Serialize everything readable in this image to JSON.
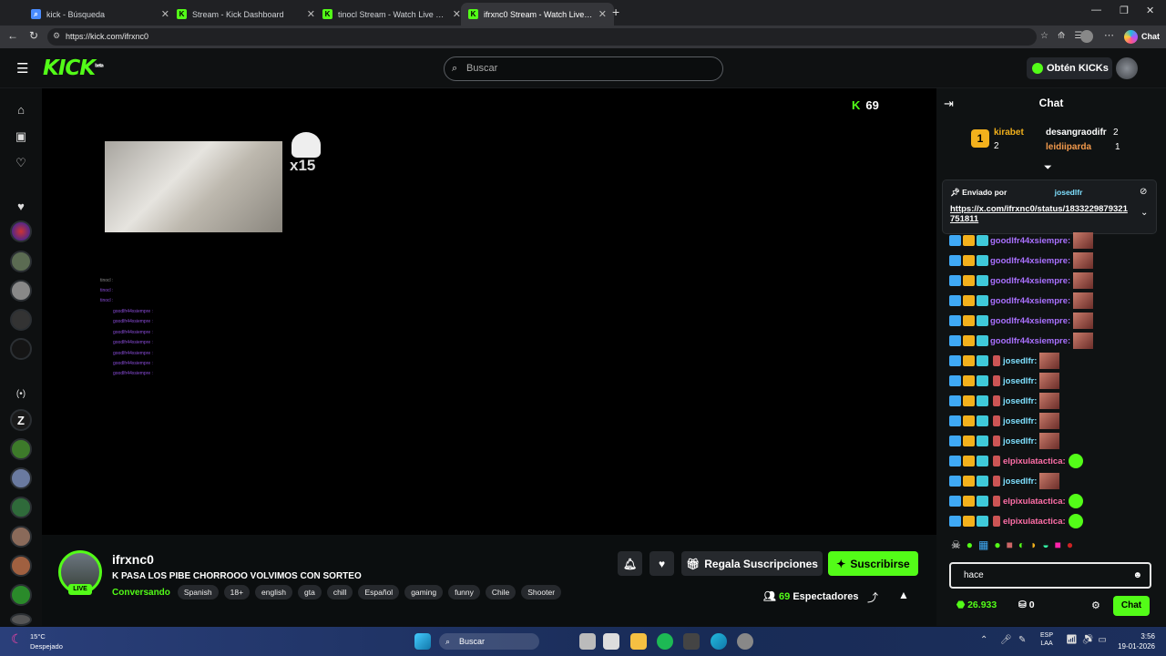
{
  "browser": {
    "tabs": [
      {
        "title": "kick - Búsqueda",
        "active": false
      },
      {
        "title": "Stream - Kick Dashboard",
        "active": false
      },
      {
        "title": "tinocl Stream - Watch Live on Kick",
        "active": false
      },
      {
        "title": "ifrxnc0 Stream - Watch Live on Kick",
        "active": true
      }
    ],
    "url": "https://kick.com/ifrxnc0",
    "chat_btn": "Chat"
  },
  "header": {
    "logo": "KICK",
    "logo_badge": "beta",
    "search_placeholder": "Buscar",
    "kicks_label": "Obtén KICKs"
  },
  "player": {
    "viewers": "69",
    "overlay_counter": "x15",
    "overlay_chat": [
      "tinocl : ",
      "tinocl : ",
      "tinocl : ",
      "goodlfr44xsiempre : ",
      "goodlfr44xsiempre : ",
      "goodlfr44xsiempre : ",
      "goodlfr44xsiempre : ",
      "goodlfr44xsiempre : ",
      "goodlfr44xsiempre : ",
      "goodlfr44xsiempre : "
    ]
  },
  "stream": {
    "name": "ifrxnc0",
    "live": "LIVE",
    "title": "K PASA LOS PIBE CHORROOO VOLVIMOS CON SORTEO",
    "category": "Conversando",
    "tags": [
      "Spanish",
      "18+",
      "english",
      "gta",
      "chill",
      "Español",
      "gaming",
      "funny",
      "Chile",
      "Shooter"
    ],
    "gift_label": "Regala Suscripciones",
    "subscribe_label": "Suscribirse",
    "viewers": "69",
    "viewers_label": "Espectadores"
  },
  "chat": {
    "title": "Chat",
    "leaderboard": {
      "rank1": {
        "name": "kirabet",
        "value": "2"
      },
      "rank2": {
        "name": "desangraodifr",
        "value": "2"
      },
      "rank3": {
        "name": "leidiiparda",
        "value": "1"
      }
    },
    "pinned": {
      "label": "Enviado por",
      "user": "josedlfr",
      "link": "https://x.com/ifrxnc0/status/1833229879321751811"
    },
    "messages": [
      {
        "user": "goodlfr44xsiempre:",
        "color": "#a970ff"
      },
      {
        "user": "goodlfr44xsiempre:",
        "color": "#a970ff"
      },
      {
        "user": "goodlfr44xsiempre:",
        "color": "#a970ff"
      },
      {
        "user": "goodlfr44xsiempre:",
        "color": "#a970ff"
      },
      {
        "user": "goodlfr44xsiempre:",
        "color": "#a970ff"
      },
      {
        "user": "goodlfr44xsiempre:",
        "color": "#a970ff"
      },
      {
        "user": "josedlfr:",
        "color": "#7fe0ff"
      },
      {
        "user": "josedlfr:",
        "color": "#7fe0ff"
      },
      {
        "user": "josedlfr:",
        "color": "#7fe0ff"
      },
      {
        "user": "josedlfr:",
        "color": "#7fe0ff"
      },
      {
        "user": "josedlfr:",
        "color": "#7fe0ff"
      },
      {
        "user": "elpixulatactica:",
        "color": "#ff6fa8"
      },
      {
        "user": "josedlfr:",
        "color": "#7fe0ff"
      },
      {
        "user": "elpixulatactica:",
        "color": "#ff6fa8"
      },
      {
        "user": "elpixulatactica:",
        "color": "#ff6fa8"
      }
    ],
    "input_value": "hace",
    "points": "26.933",
    "gifts": "0",
    "send_label": "Chat"
  },
  "taskbar": {
    "temp": "15°C",
    "weather": "Despejado",
    "search": "Buscar",
    "lang1": "ESP",
    "lang2": "LAA",
    "time": "3:56",
    "date": "19-01-2026"
  },
  "colors": {
    "accent": "#53fc18",
    "bg": "#0b0e0f"
  }
}
